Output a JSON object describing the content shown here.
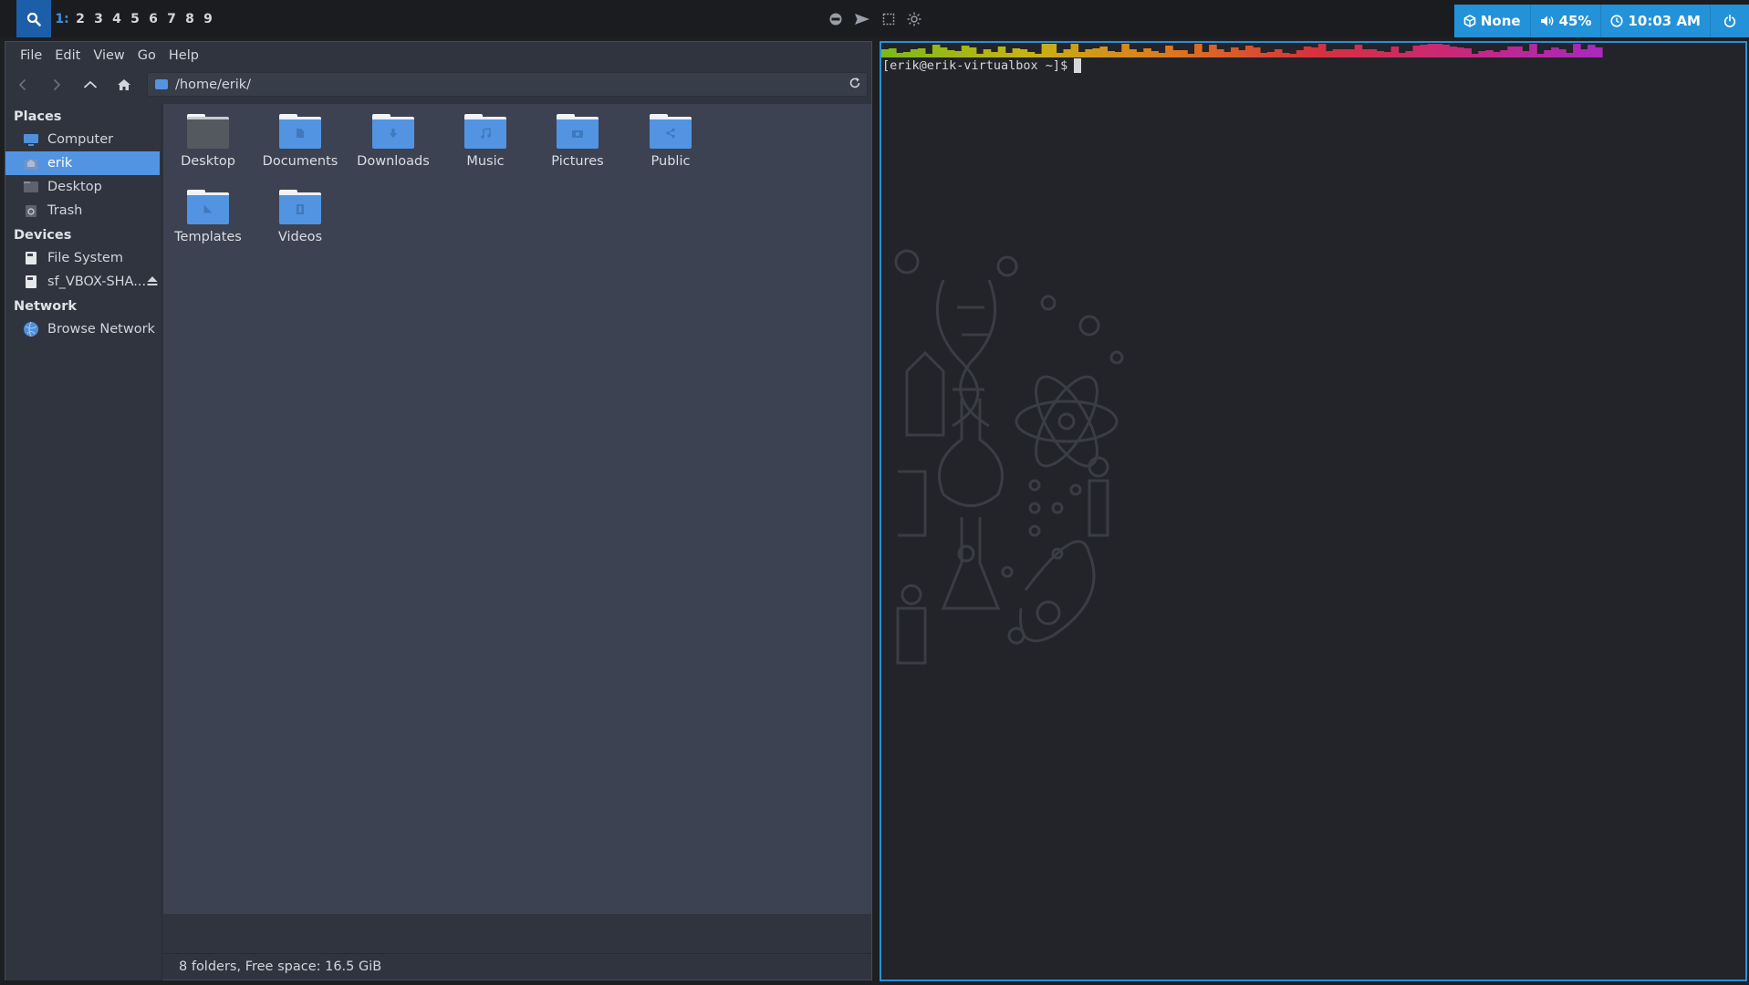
{
  "topbar": {
    "search_icon": "search-icon",
    "workspaces": [
      {
        "label": "1:",
        "active": true
      },
      {
        "label": "2"
      },
      {
        "label": "3"
      },
      {
        "label": "4"
      },
      {
        "label": "5"
      },
      {
        "label": "6"
      },
      {
        "label": "7"
      },
      {
        "label": "8"
      },
      {
        "label": "9"
      }
    ],
    "tray_icons": [
      "vpn-icon",
      "send-icon",
      "screenshot-icon",
      "brightness-icon"
    ],
    "network": {
      "icon": "network-icon",
      "label": "None"
    },
    "volume": {
      "icon": "volume-icon",
      "label": "45%"
    },
    "clock": {
      "icon": "clock-icon",
      "label": "10:03 AM"
    },
    "power_icon": "power-icon",
    "accent": "#2392d9"
  },
  "file_manager": {
    "menu": [
      "File",
      "Edit",
      "View",
      "Go",
      "Help"
    ],
    "path": "/home/erik/",
    "sidebar": {
      "places_title": "Places",
      "places": [
        {
          "label": "Computer",
          "icon": "computer-icon"
        },
        {
          "label": "erik",
          "icon": "home-icon",
          "selected": true
        },
        {
          "label": "Desktop",
          "icon": "desktop-folder-icon"
        },
        {
          "label": "Trash",
          "icon": "trash-icon"
        }
      ],
      "devices_title": "Devices",
      "devices": [
        {
          "label": "File System",
          "icon": "drive-icon"
        },
        {
          "label": "sf_VBOX-SHA...",
          "icon": "drive-icon",
          "ejectable": true
        }
      ],
      "network_title": "Network",
      "network": [
        {
          "label": "Browse Network",
          "icon": "network-globe-icon"
        }
      ]
    },
    "folders": [
      {
        "label": "Desktop",
        "icon": "desktop-folder-icon"
      },
      {
        "label": "Documents",
        "icon": "documents-folder-icon"
      },
      {
        "label": "Downloads",
        "icon": "downloads-folder-icon"
      },
      {
        "label": "Music",
        "icon": "music-folder-icon"
      },
      {
        "label": "Pictures",
        "icon": "pictures-folder-icon"
      },
      {
        "label": "Public",
        "icon": "public-folder-icon"
      },
      {
        "label": "Templates",
        "icon": "templates-folder-icon"
      },
      {
        "label": "Videos",
        "icon": "videos-folder-icon"
      }
    ],
    "status": "8 folders, Free space: 16.5 GiB",
    "selection_color": "#5294e2"
  },
  "terminal": {
    "prompt": "[erik@erik-virtualbox ~]$",
    "border_color": "#2b8fd8"
  }
}
